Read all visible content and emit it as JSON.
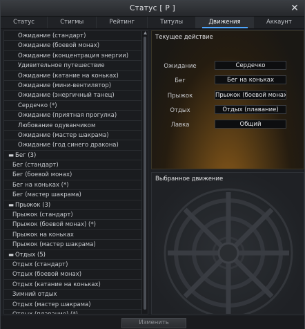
{
  "window": {
    "title": "Статус [ P ]"
  },
  "tabs": [
    {
      "label": "Статус"
    },
    {
      "label": "Стигмы"
    },
    {
      "label": "Рейтинг"
    },
    {
      "label": "Титулы"
    },
    {
      "label": "Движения"
    },
    {
      "label": "Аккаунт"
    }
  ],
  "motion_list": [
    {
      "type": "sub",
      "label": "Ожидание (стандарт)"
    },
    {
      "type": "sub",
      "label": "Ожидание (боевой монах)"
    },
    {
      "type": "sub",
      "label": "Ожидание (концентрация энергии)"
    },
    {
      "type": "sub",
      "label": "Удивительное путешествие"
    },
    {
      "type": "sub",
      "label": "Ожидание (катание на коньках)"
    },
    {
      "type": "sub",
      "label": "Ожидание (мини-вентилятор)"
    },
    {
      "type": "sub",
      "label": "Ожидание (энергичный танец)"
    },
    {
      "type": "sub",
      "label": "Сердечко (*)"
    },
    {
      "type": "sub",
      "label": "Ожидание (приятная прогулка)"
    },
    {
      "type": "sub",
      "label": "Любование одуванчиком"
    },
    {
      "type": "sub",
      "label": "Ожидание (мастер шакрама)"
    },
    {
      "type": "sub",
      "label": "Ожидание (год синего дракона)"
    },
    {
      "type": "group",
      "toggle": "▬",
      "label": "Бег (3)"
    },
    {
      "type": "sub2",
      "label": "Бег (стандарт)"
    },
    {
      "type": "sub2",
      "label": "Бег (боевой монах)"
    },
    {
      "type": "sub2",
      "label": "Бег на коньках (*)"
    },
    {
      "type": "sub2",
      "label": "Бег (мастер шакрама)"
    },
    {
      "type": "group",
      "toggle": "▬",
      "label": "Прыжок (3)"
    },
    {
      "type": "sub2",
      "label": "Прыжок (стандарт)"
    },
    {
      "type": "sub2",
      "label": "Прыжок (боевой монах) (*)"
    },
    {
      "type": "sub2",
      "label": "Прыжок на коньках"
    },
    {
      "type": "sub2",
      "label": "Прыжок (мастер шакрама)"
    },
    {
      "type": "group",
      "toggle": "▬",
      "label": "Отдых (5)"
    },
    {
      "type": "sub2",
      "label": "Отдых (стандарт)"
    },
    {
      "type": "sub2",
      "label": "Отдых (боевой монах)"
    },
    {
      "type": "sub2",
      "label": "Отдых (катание на коньках)"
    },
    {
      "type": "sub2",
      "label": "Зимний отдых"
    },
    {
      "type": "sub2",
      "label": "Отдых (мастер шакрама)"
    },
    {
      "type": "sub2",
      "label": "Отдых (плавание) (*)"
    }
  ],
  "current_action": {
    "heading": "Текущее действие",
    "rows": [
      {
        "label": "Ожидание",
        "value": "Сердечко"
      },
      {
        "label": "Бег",
        "value": "Бег на коньках"
      },
      {
        "label": "Прыжок",
        "value": "Прыжок (боевой монах)"
      },
      {
        "label": "Отдых",
        "value": "Отдых (плавание)"
      },
      {
        "label": "Лавка",
        "value": "Общий"
      }
    ]
  },
  "selected_motion": {
    "heading": "Выбранное движение"
  },
  "change_button": {
    "label": "Изменить"
  },
  "colors": {
    "accent": "#4fa7ff",
    "panel_glow": "#8a5a1a"
  }
}
